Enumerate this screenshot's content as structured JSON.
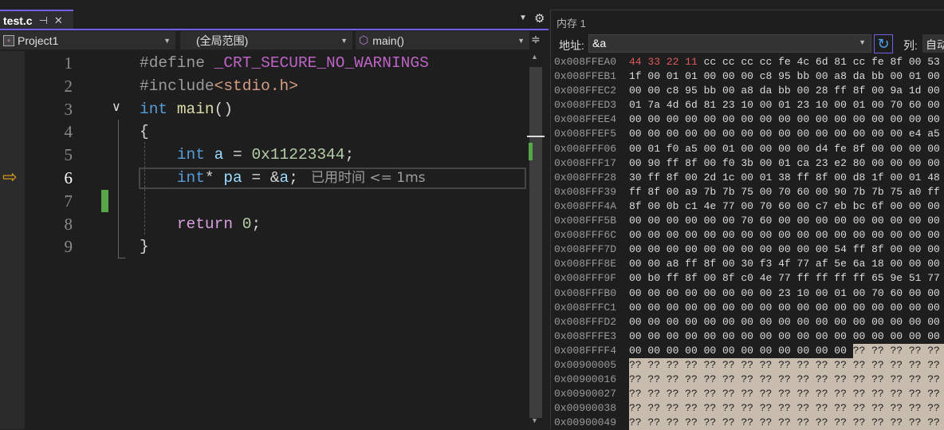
{
  "editor": {
    "tab": {
      "name": "test.c",
      "pin_icon": "pin-icon",
      "close_icon": "close-icon"
    },
    "nav": {
      "project": "Project1",
      "scope": "(全局范围)",
      "function": "main()"
    },
    "lines": [
      {
        "n": "1",
        "tokens": [
          [
            "pp",
            "#define "
          ],
          [
            "mac",
            "_CRT_SECURE_NO_WARNINGS"
          ]
        ]
      },
      {
        "n": "2",
        "tokens": [
          [
            "pp",
            "#include"
          ],
          [
            "str",
            "<stdio.h>"
          ]
        ]
      },
      {
        "n": "3",
        "tokens": [
          [
            "kw",
            "int "
          ],
          [
            "fn",
            "main"
          ],
          [
            "op",
            "()"
          ]
        ]
      },
      {
        "n": "4",
        "tokens": [
          [
            "op",
            "{"
          ]
        ]
      },
      {
        "n": "5",
        "tokens": [
          [
            "op",
            "    "
          ],
          [
            "kw",
            "int "
          ],
          [
            "id",
            "a"
          ],
          [
            "op",
            " = "
          ],
          [
            "num",
            "0x11223344"
          ],
          [
            "op",
            ";"
          ]
        ]
      },
      {
        "n": "6",
        "tokens": [
          [
            "op",
            "    "
          ],
          [
            "kw",
            "int"
          ],
          [
            "op",
            "* "
          ],
          [
            "id",
            "pa"
          ],
          [
            "op",
            " = &"
          ],
          [
            "id",
            "a"
          ],
          [
            "op",
            ";"
          ]
        ]
      },
      {
        "n": "7",
        "tokens": []
      },
      {
        "n": "8",
        "tokens": [
          [
            "op",
            "    "
          ],
          [
            "ret",
            "return "
          ],
          [
            "num",
            "0"
          ],
          [
            "op",
            ";"
          ]
        ]
      },
      {
        "n": "9",
        "tokens": [
          [
            "op",
            "}"
          ]
        ]
      }
    ],
    "current_line": "6",
    "perf_tip": "已用时间 <= 1ms"
  },
  "memory": {
    "title": "内存 1",
    "address_label": "地址:",
    "address_value": "&a",
    "columns_label": "列:",
    "columns_value": "自动",
    "colors": {
      "changed": "#e05a5a",
      "unknown_bg": "#c8bcae"
    },
    "rows": [
      {
        "addr": "0x008FFEA0",
        "bytes": "44 33 22 11 cc cc cc cc fe 4c 6d 81 cc fe 8f 00 53",
        "changed": 4
      },
      {
        "addr": "0x008FFEB1",
        "bytes": "1f 00 01 01 00 00 00 c8 95 bb 00 a8 da bb 00 01 00"
      },
      {
        "addr": "0x008FFEC2",
        "bytes": "00 00 c8 95 bb 00 a8 da bb 00 28 ff 8f 00 9a 1d 00"
      },
      {
        "addr": "0x008FFED3",
        "bytes": "01 7a 4d 6d 81 23 10 00 01 23 10 00 01 00 70 60 00"
      },
      {
        "addr": "0x008FFEE4",
        "bytes": "00 00 00 00 00 00 00 00 00 00 00 00 00 00 00 00 00"
      },
      {
        "addr": "0x008FFEF5",
        "bytes": "00 00 00 00 00 00 00 00 00 00 00 00 00 00 00 e4 a5"
      },
      {
        "addr": "0x008FFF06",
        "bytes": "00 01 f0 a5 00 01 00 00 00 00 d4 fe 8f 00 00 00 00"
      },
      {
        "addr": "0x008FFF17",
        "bytes": "00 90 ff 8f 00 f0 3b 00 01 ca 23 e2 80 00 00 00 00"
      },
      {
        "addr": "0x008FFF28",
        "bytes": "30 ff 8f 00 2d 1c 00 01 38 ff 8f 00 d8 1f 00 01 48"
      },
      {
        "addr": "0x008FFF39",
        "bytes": "ff 8f 00 a9 7b 7b 75 00 70 60 00 90 7b 7b 75 a0 ff"
      },
      {
        "addr": "0x008FFF4A",
        "bytes": "8f 00 0b c1 4e 77 00 70 60 00 c7 eb bc 6f 00 00 00"
      },
      {
        "addr": "0x008FFF5B",
        "bytes": "00 00 00 00 00 00 70 60 00 00 00 00 00 00 00 00 00"
      },
      {
        "addr": "0x008FFF6C",
        "bytes": "00 00 00 00 00 00 00 00 00 00 00 00 00 00 00 00 00"
      },
      {
        "addr": "0x008FFF7D",
        "bytes": "00 00 00 00 00 00 00 00 00 00 00 54 ff 8f 00 00 00"
      },
      {
        "addr": "0x008FFF8E",
        "bytes": "00 00 a8 ff 8f 00 30 f3 4f 77 af 5e 6a 18 00 00 00"
      },
      {
        "addr": "0x008FFF9F",
        "bytes": "00 b0 ff 8f 00 8f c0 4e 77 ff ff ff ff 65 9e 51 77"
      },
      {
        "addr": "0x008FFFB0",
        "bytes": "00 00 00 00 00 00 00 00 23 10 00 01 00 70 60 00 00"
      },
      {
        "addr": "0x008FFFC1",
        "bytes": "00 00 00 00 00 00 00 00 00 00 00 00 00 00 00 00 00"
      },
      {
        "addr": "0x008FFFD2",
        "bytes": "00 00 00 00 00 00 00 00 00 00 00 00 00 00 00 00 00"
      },
      {
        "addr": "0x008FFFE3",
        "bytes": "00 00 00 00 00 00 00 00 00 00 00 00 00 00 00 00 00"
      },
      {
        "addr": "0x008FFFF4",
        "bytes": "00 00 00 00 00 00 00 00 00 00 00 00 ?? ?? ?? ?? ??"
      },
      {
        "addr": "0x00900005",
        "bytes": "?? ?? ?? ?? ?? ?? ?? ?? ?? ?? ?? ?? ?? ?? ?? ?? ??"
      },
      {
        "addr": "0x00900016",
        "bytes": "?? ?? ?? ?? ?? ?? ?? ?? ?? ?? ?? ?? ?? ?? ?? ?? ??"
      },
      {
        "addr": "0x00900027",
        "bytes": "?? ?? ?? ?? ?? ?? ?? ?? ?? ?? ?? ?? ?? ?? ?? ?? ??"
      },
      {
        "addr": "0x00900038",
        "bytes": "?? ?? ?? ?? ?? ?? ?? ?? ?? ?? ?? ?? ?? ?? ?? ?? ??"
      },
      {
        "addr": "0x00900049",
        "bytes": "?? ?? ?? ?? ?? ?? ?? ?? ?? ?? ?? ?? ?? ?? ?? ?? ??"
      }
    ]
  }
}
